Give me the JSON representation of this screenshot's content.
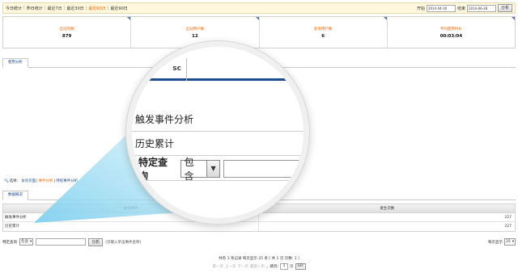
{
  "date_bar": {
    "ranges": [
      {
        "label": "今日统计",
        "active": false
      },
      {
        "label": "昨日统计",
        "active": false
      },
      {
        "label": "最近7日",
        "active": false
      },
      {
        "label": "最近30日",
        "active": false
      },
      {
        "label": "最近60日",
        "active": true
      },
      {
        "label": "最近90日",
        "active": false
      }
    ],
    "start_label": "开始",
    "start_value": "2014-04-30",
    "end_label": "结束",
    "end_value": "2014-06-28",
    "analyze_label": "分析"
  },
  "stats": [
    {
      "label": "启动次数",
      "value": "879"
    },
    {
      "label": "启动用户数",
      "value": "12"
    },
    {
      "label": "新增用户数",
      "value": "6"
    },
    {
      "label": "平均使用时长",
      "value": "00:03:04"
    }
  ],
  "usage_tab": {
    "label": "使用分析"
  },
  "select_line": {
    "prefix": "选择：",
    "links": [
      {
        "label": "访问页面",
        "active": false
      },
      {
        "label": "事件分析",
        "active": true
      },
      {
        "label": "持续事件分析",
        "active": false
      }
    ]
  },
  "overview_tab": {
    "label": "数据概况"
  },
  "table": {
    "columns": [
      "触发事件",
      "发生次数"
    ],
    "rows": [
      {
        "name": "触发事件分析",
        "count": "227"
      },
      {
        "name": "历史累计",
        "count": "227"
      }
    ]
  },
  "filter": {
    "label": "特定查询",
    "operator": "包含",
    "analyze_label": "分析",
    "hint": "(仅输入单击事件名称)",
    "perpage_label": "每页显示",
    "perpage_value": "25"
  },
  "pager": {
    "summary": "共有 1 条记录 每页显示 25 条 [ 共 1 页 页数: 1 ]",
    "first": "第一页",
    "prev": "上一页",
    "next": "下一页",
    "last": "最后一页",
    "goto_label": "，跳到:",
    "page_value": "1",
    "page_unit": "页",
    "go_label": "GO"
  },
  "magnifier": {
    "tab_fragment": "sc",
    "row_1": "触发事件分析",
    "row_2": "历史累计",
    "filter_label": "特定查询",
    "operator": "包含",
    "arrow": "▼"
  },
  "colors": {
    "accent_orange": "#ff6600",
    "link_blue": "#1f4b8f",
    "bar_bg": "#fff8dc"
  }
}
